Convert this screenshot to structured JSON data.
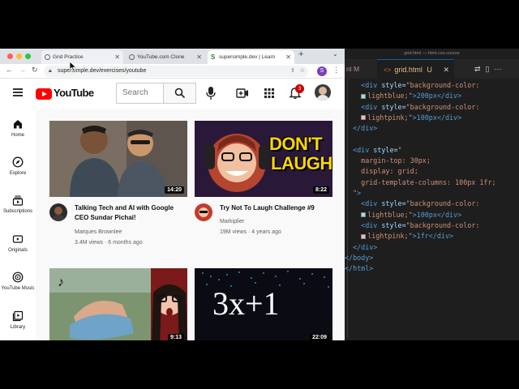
{
  "browser": {
    "tabs": [
      {
        "title": "Grid Practice",
        "active": true
      },
      {
        "title": "YouTube.com Clone",
        "active": false
      },
      {
        "title": "supersimple.dev | Learn",
        "active": true
      }
    ],
    "profile_initial": "S",
    "url": "supersimple.dev/exercises/youtube"
  },
  "youtube": {
    "logo_text": "YouTube",
    "search_placeholder": "Search",
    "notification_count": "3",
    "sidebar": [
      {
        "label": "Home",
        "icon": "home-icon"
      },
      {
        "label": "Explore",
        "icon": "explore-icon"
      },
      {
        "label": "Subscriptions",
        "icon": "subscriptions-icon"
      },
      {
        "label": "Originals",
        "icon": "originals-icon"
      },
      {
        "label": "YouTube Music",
        "icon": "youtube-music-icon"
      },
      {
        "label": "Library",
        "icon": "library-icon"
      }
    ],
    "videos": [
      {
        "title": "Talking Tech and AI with Google CEO Sundar Pichai!",
        "channel": "Marques Brownlee",
        "meta": "3.4M views · 6 months ago",
        "duration": "14:20"
      },
      {
        "title": "Try Not To Laugh Challenge #9",
        "channel": "Markiplier",
        "meta": "19M views · 4 years ago",
        "duration": "8:22",
        "thumb_text_1": "DON'T",
        "thumb_text_2": "LAUGH"
      },
      {
        "title": "",
        "channel": "",
        "meta": "",
        "duration": "9:13"
      },
      {
        "title": "",
        "channel": "",
        "meta": "",
        "duration": "22:09",
        "thumb_text": "3x+1"
      }
    ]
  },
  "editor": {
    "window_title": "grid.html — html-css-course",
    "tab_prev": "nl M",
    "tab_active": "grid.html",
    "tab_active_badge": "U",
    "lines": [
      {
        "indent": "    ",
        "tag": "<div",
        "attr": " style=",
        "str": "\"background-color:"
      },
      {
        "indent": "    ",
        "swatch": "#add8e6",
        "str": "lightblue;\"",
        "tag": ">200px</div>"
      },
      {
        "indent": "    ",
        "tag": "<div",
        "attr": " style=",
        "str": "\"background-color:"
      },
      {
        "indent": "    ",
        "swatch": "#ffb6c1",
        "str": "lightpink;\"",
        "tag": ">100px</div>"
      },
      {
        "indent": "  ",
        "tag": "</div>"
      },
      {
        "indent": "",
        "tag": ""
      },
      {
        "indent": "  ",
        "tag": "<div",
        "attr": " style=",
        "str": "\""
      },
      {
        "indent": "    ",
        "str": "margin-top: 30px;"
      },
      {
        "indent": "    ",
        "str": "display: grid;"
      },
      {
        "indent": "    ",
        "str": "grid-template-columns: 100px 1fr;"
      },
      {
        "indent": "  ",
        "str": "\"",
        "tag": ">"
      },
      {
        "indent": "    ",
        "tag": "<div",
        "attr": " style=",
        "str": "\"background-color:"
      },
      {
        "indent": "    ",
        "swatch": "#add8e6",
        "str": "lightblue;\"",
        "tag": ">100px</div>"
      },
      {
        "indent": "    ",
        "tag": "<div",
        "attr": " style=",
        "str": "\"background-color:"
      },
      {
        "indent": "    ",
        "swatch": "#ffb6c1",
        "str": "lightpink;\"",
        "tag": ">1fr</div>"
      },
      {
        "indent": "  ",
        "tag": "</div>"
      },
      {
        "indent": "",
        "tag": "</body>"
      },
      {
        "indent": "",
        "tag": "</html>"
      }
    ]
  }
}
